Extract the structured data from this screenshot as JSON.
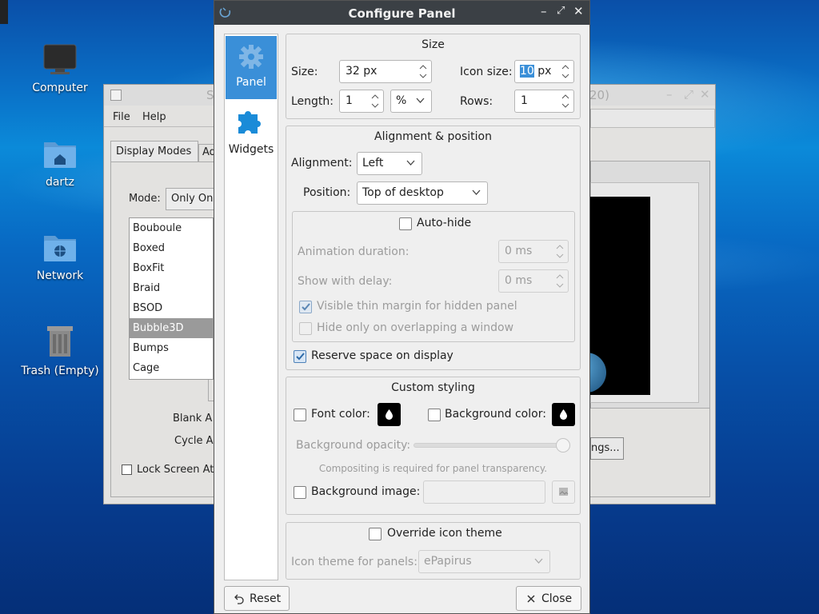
{
  "desktop": {
    "icons": [
      {
        "label": "Computer",
        "icon": "monitor-icon"
      },
      {
        "label": "dartz",
        "icon": "home-folder-icon"
      },
      {
        "label": "Network",
        "icon": "network-folder-icon"
      },
      {
        "label": "Trash (Empty)",
        "icon": "trash-icon"
      }
    ]
  },
  "back_window": {
    "title_fragment": "S",
    "title_suffix": "20)",
    "menu": [
      "File",
      "Help"
    ],
    "tabs": [
      "Display Modes",
      "Ad"
    ],
    "mode_label": "Mode:",
    "mode_value": "Only On",
    "list": [
      "Bouboule",
      "Boxed",
      "BoxFit",
      "Braid",
      "BSOD",
      "Bubble3D",
      "Bumps",
      "Cage"
    ],
    "selected_item": "Bubble3D",
    "blank_label": "Blank A",
    "cycle_label": "Cycle A",
    "lock_label": "Lock Screen At",
    "settings_button": "ngs..."
  },
  "dialog": {
    "title": "Configure Panel",
    "sidebar": [
      {
        "label": "Panel",
        "icon": "gear-icon",
        "selected": true
      },
      {
        "label": "Widgets",
        "icon": "puzzle-icon",
        "selected": false
      }
    ],
    "size_group": {
      "title": "Size",
      "size_label": "Size:",
      "size_value": "32 px",
      "icon_size_label": "Icon size:",
      "icon_size_selected": "10",
      "icon_size_unit": "px",
      "length_label": "Length:",
      "length_value": "1",
      "length_unit": "%",
      "rows_label": "Rows:",
      "rows_value": "1"
    },
    "alignment_group": {
      "title": "Alignment & position",
      "alignment_label": "Alignment:",
      "alignment_value": "Left",
      "position_label": "Position:",
      "position_value": "Top of desktop",
      "autohide_label": "Auto-hide",
      "autohide_checked": false,
      "animation_label": "Animation duration:",
      "animation_value": "0 ms",
      "delay_label": "Show with delay:",
      "delay_value": "0 ms",
      "thin_margin_label": "Visible thin margin for hidden panel",
      "thin_margin_checked": true,
      "overlap_label": "Hide only on overlapping a window",
      "overlap_checked": false,
      "reserve_label": "Reserve space on display",
      "reserve_checked": true
    },
    "styling_group": {
      "title": "Custom styling",
      "font_color_label": "Font color:",
      "bg_color_label": "Background color:",
      "opacity_label": "Background opacity:",
      "opacity_level": 1.0,
      "compositing_note": "Compositing is required for panel transparency.",
      "bg_image_label": "Background image:",
      "swatch_color": "#000000"
    },
    "icon_theme_group": {
      "override_label": "Override icon theme",
      "theme_label": "Icon theme for panels:",
      "theme_value": "ePapirus"
    },
    "buttons": {
      "reset": "Reset",
      "close": "Close"
    }
  },
  "colors": {
    "titlebar": "#3b4045",
    "selection": "#3a8fd8",
    "check_accent": "#3070b0"
  }
}
